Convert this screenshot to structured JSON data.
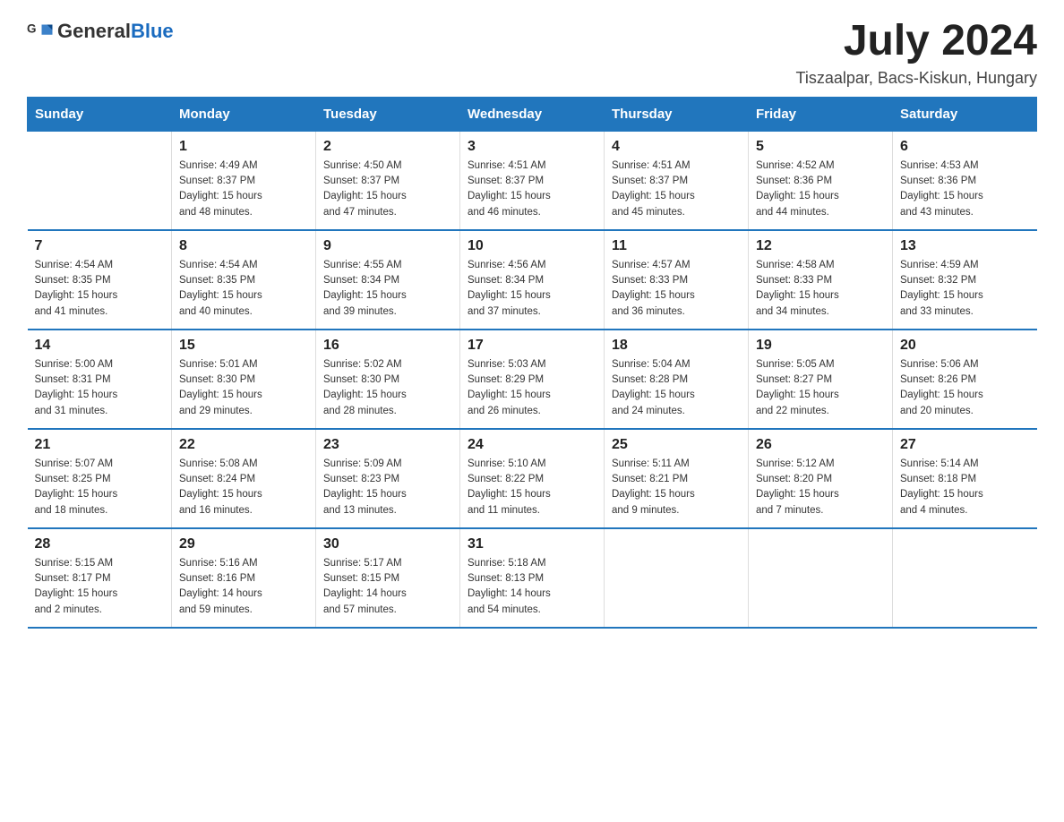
{
  "header": {
    "logo_general": "General",
    "logo_blue": "Blue",
    "month_year": "July 2024",
    "location": "Tiszaalpar, Bacs-Kiskun, Hungary"
  },
  "days_of_week": [
    "Sunday",
    "Monday",
    "Tuesday",
    "Wednesday",
    "Thursday",
    "Friday",
    "Saturday"
  ],
  "weeks": [
    [
      {
        "day": "",
        "info": ""
      },
      {
        "day": "1",
        "info": "Sunrise: 4:49 AM\nSunset: 8:37 PM\nDaylight: 15 hours\nand 48 minutes."
      },
      {
        "day": "2",
        "info": "Sunrise: 4:50 AM\nSunset: 8:37 PM\nDaylight: 15 hours\nand 47 minutes."
      },
      {
        "day": "3",
        "info": "Sunrise: 4:51 AM\nSunset: 8:37 PM\nDaylight: 15 hours\nand 46 minutes."
      },
      {
        "day": "4",
        "info": "Sunrise: 4:51 AM\nSunset: 8:37 PM\nDaylight: 15 hours\nand 45 minutes."
      },
      {
        "day": "5",
        "info": "Sunrise: 4:52 AM\nSunset: 8:36 PM\nDaylight: 15 hours\nand 44 minutes."
      },
      {
        "day": "6",
        "info": "Sunrise: 4:53 AM\nSunset: 8:36 PM\nDaylight: 15 hours\nand 43 minutes."
      }
    ],
    [
      {
        "day": "7",
        "info": "Sunrise: 4:54 AM\nSunset: 8:35 PM\nDaylight: 15 hours\nand 41 minutes."
      },
      {
        "day": "8",
        "info": "Sunrise: 4:54 AM\nSunset: 8:35 PM\nDaylight: 15 hours\nand 40 minutes."
      },
      {
        "day": "9",
        "info": "Sunrise: 4:55 AM\nSunset: 8:34 PM\nDaylight: 15 hours\nand 39 minutes."
      },
      {
        "day": "10",
        "info": "Sunrise: 4:56 AM\nSunset: 8:34 PM\nDaylight: 15 hours\nand 37 minutes."
      },
      {
        "day": "11",
        "info": "Sunrise: 4:57 AM\nSunset: 8:33 PM\nDaylight: 15 hours\nand 36 minutes."
      },
      {
        "day": "12",
        "info": "Sunrise: 4:58 AM\nSunset: 8:33 PM\nDaylight: 15 hours\nand 34 minutes."
      },
      {
        "day": "13",
        "info": "Sunrise: 4:59 AM\nSunset: 8:32 PM\nDaylight: 15 hours\nand 33 minutes."
      }
    ],
    [
      {
        "day": "14",
        "info": "Sunrise: 5:00 AM\nSunset: 8:31 PM\nDaylight: 15 hours\nand 31 minutes."
      },
      {
        "day": "15",
        "info": "Sunrise: 5:01 AM\nSunset: 8:30 PM\nDaylight: 15 hours\nand 29 minutes."
      },
      {
        "day": "16",
        "info": "Sunrise: 5:02 AM\nSunset: 8:30 PM\nDaylight: 15 hours\nand 28 minutes."
      },
      {
        "day": "17",
        "info": "Sunrise: 5:03 AM\nSunset: 8:29 PM\nDaylight: 15 hours\nand 26 minutes."
      },
      {
        "day": "18",
        "info": "Sunrise: 5:04 AM\nSunset: 8:28 PM\nDaylight: 15 hours\nand 24 minutes."
      },
      {
        "day": "19",
        "info": "Sunrise: 5:05 AM\nSunset: 8:27 PM\nDaylight: 15 hours\nand 22 minutes."
      },
      {
        "day": "20",
        "info": "Sunrise: 5:06 AM\nSunset: 8:26 PM\nDaylight: 15 hours\nand 20 minutes."
      }
    ],
    [
      {
        "day": "21",
        "info": "Sunrise: 5:07 AM\nSunset: 8:25 PM\nDaylight: 15 hours\nand 18 minutes."
      },
      {
        "day": "22",
        "info": "Sunrise: 5:08 AM\nSunset: 8:24 PM\nDaylight: 15 hours\nand 16 minutes."
      },
      {
        "day": "23",
        "info": "Sunrise: 5:09 AM\nSunset: 8:23 PM\nDaylight: 15 hours\nand 13 minutes."
      },
      {
        "day": "24",
        "info": "Sunrise: 5:10 AM\nSunset: 8:22 PM\nDaylight: 15 hours\nand 11 minutes."
      },
      {
        "day": "25",
        "info": "Sunrise: 5:11 AM\nSunset: 8:21 PM\nDaylight: 15 hours\nand 9 minutes."
      },
      {
        "day": "26",
        "info": "Sunrise: 5:12 AM\nSunset: 8:20 PM\nDaylight: 15 hours\nand 7 minutes."
      },
      {
        "day": "27",
        "info": "Sunrise: 5:14 AM\nSunset: 8:18 PM\nDaylight: 15 hours\nand 4 minutes."
      }
    ],
    [
      {
        "day": "28",
        "info": "Sunrise: 5:15 AM\nSunset: 8:17 PM\nDaylight: 15 hours\nand 2 minutes."
      },
      {
        "day": "29",
        "info": "Sunrise: 5:16 AM\nSunset: 8:16 PM\nDaylight: 14 hours\nand 59 minutes."
      },
      {
        "day": "30",
        "info": "Sunrise: 5:17 AM\nSunset: 8:15 PM\nDaylight: 14 hours\nand 57 minutes."
      },
      {
        "day": "31",
        "info": "Sunrise: 5:18 AM\nSunset: 8:13 PM\nDaylight: 14 hours\nand 54 minutes."
      },
      {
        "day": "",
        "info": ""
      },
      {
        "day": "",
        "info": ""
      },
      {
        "day": "",
        "info": ""
      }
    ]
  ]
}
